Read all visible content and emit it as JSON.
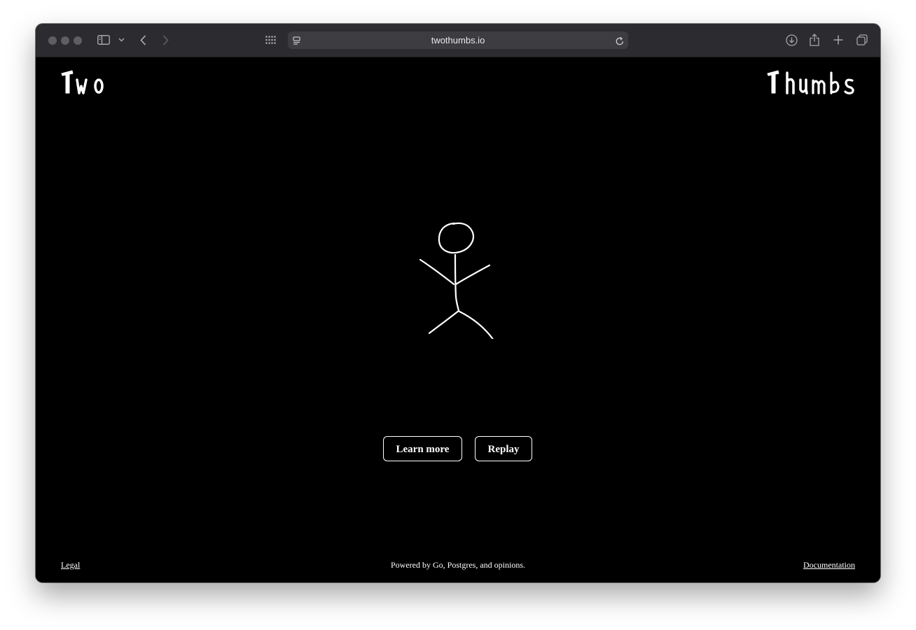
{
  "browser": {
    "url": "twothumbs.io",
    "icons": {
      "sidebar": "sidebar-icon",
      "sidebar_menu": "chevron-down-icon",
      "back": "back-arrow-icon",
      "forward": "forward-arrow-icon",
      "tab_overview": "grid-icon",
      "page_menu": "page-settings-icon",
      "reload": "reload-icon",
      "downloads": "download-icon",
      "share": "share-icon",
      "new_tab": "plus-icon",
      "tabs": "tab-overview-icon"
    }
  },
  "page": {
    "logo_left": "Two",
    "logo_right": "Thumbs",
    "buttons": {
      "learn_more": "Learn more",
      "replay": "Replay"
    },
    "footer": {
      "legal": "Legal",
      "tagline": "Powered by Go, Postgres, and opinions.",
      "documentation": "Documentation"
    }
  },
  "colors": {
    "background": "#000000",
    "foreground": "#ffffff",
    "toolbar": "#2c2b2f",
    "urlbar": "#3d3c41"
  }
}
